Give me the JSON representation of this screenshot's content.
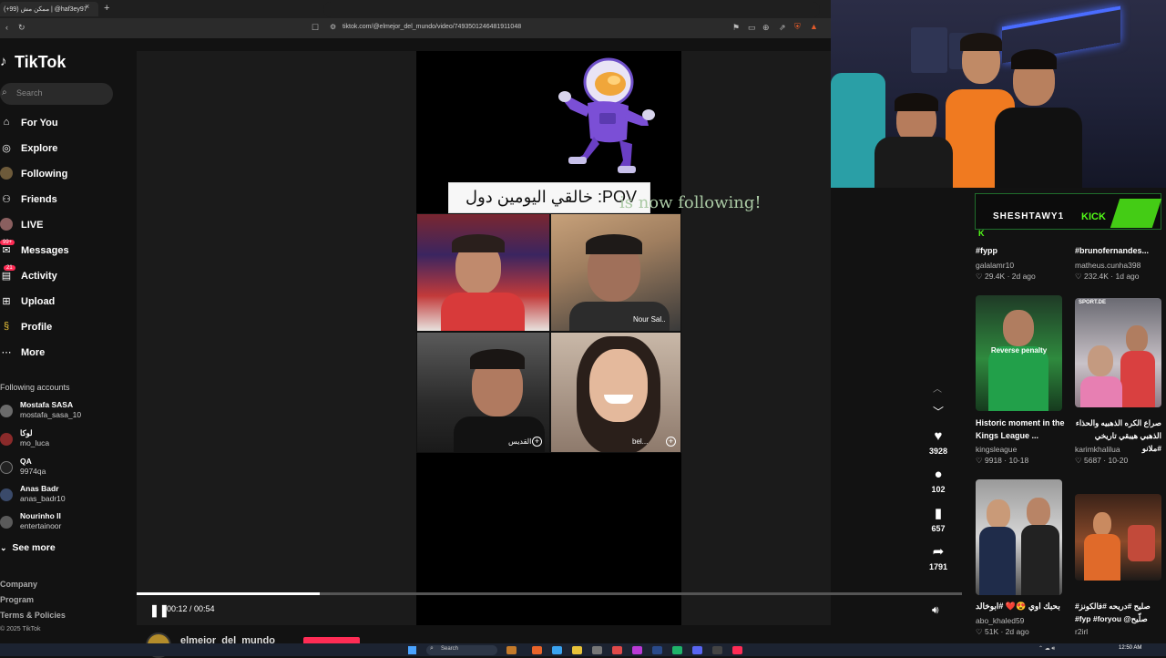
{
  "browser": {
    "tab_title": "(+99) ممكن مش | @haf3ey97",
    "tab_close": "×",
    "new_tab": "+",
    "url": "tiktok.com/@elmejor_del_mundo/video/7493501246481911048"
  },
  "sidebar": {
    "logo": "TikTok",
    "search_placeholder": "Search",
    "nav": [
      {
        "label": "For You",
        "icon": "home-icon"
      },
      {
        "label": "Explore",
        "icon": "compass-icon"
      },
      {
        "label": "Following",
        "icon": "following-icon"
      },
      {
        "label": "Friends",
        "icon": "friends-icon"
      },
      {
        "label": "LIVE",
        "icon": "live-icon"
      },
      {
        "label": "Messages",
        "icon": "messages-icon",
        "badge": "99+"
      },
      {
        "label": "Activity",
        "icon": "activity-icon",
        "badge": "21"
      },
      {
        "label": "Upload",
        "icon": "upload-icon"
      },
      {
        "label": "Profile",
        "icon": "profile-icon"
      },
      {
        "label": "More",
        "icon": "more-icon"
      }
    ],
    "following_title": "Following accounts",
    "accounts": [
      {
        "name": "Mostafa SASA",
        "handle": "mostafa_sasa_10"
      },
      {
        "name": "لوكا",
        "handle": "mo_luca"
      },
      {
        "name": "QA",
        "handle": "9974qa"
      },
      {
        "name": "Anas Badr",
        "handle": "anas_badr10"
      },
      {
        "name": "Nourinho II",
        "handle": "entertainoor"
      }
    ],
    "see_more": "See more",
    "footer": [
      "Company",
      "Program",
      "Terms & Policies",
      "© 2025 TikTok"
    ]
  },
  "video": {
    "pov_text": "خالقي اليومين دول :POV",
    "follow_overlay": "is now following!",
    "tile_labels": [
      "Nour Sal..",
      "القديس",
      "bel..."
    ],
    "time": "00:12 / 00:54",
    "progress": 0.222,
    "author": "elmejor_del_mundo"
  },
  "actions": {
    "likes": "3928",
    "comments": "102",
    "saves": "657",
    "shares": "1791"
  },
  "recommendations": [
    {
      "title": "#fypp",
      "user": "galalamr10",
      "views": "29.4K",
      "date": "2d ago"
    },
    {
      "title": "#brunofernandes...",
      "user": "matheus.cunha398",
      "views": "232.4K",
      "date": "1d ago"
    },
    {
      "title": "Historic moment in the Kings League ...",
      "user": "kingsleague",
      "views": "9918",
      "date": "10-18",
      "overlay": "Reverse penalty"
    },
    {
      "title": "صراع الكره الذهبيه والحذاء الذهبي هيبقي تاريخي #ملانو",
      "user": "karimkhalilua",
      "views": "5687",
      "date": "10-20",
      "overlay": "SPORT.DE"
    },
    {
      "title": "بحبك اوي 😍❤️ #ابوخالد",
      "user": "abo_khaled59",
      "views": "51K",
      "date": "2d ago"
    },
    {
      "title": "#صليح #دريحه #فالكونز #fyp #foryou @صلّيح",
      "user": "r2irl",
      "views": "",
      "date": ""
    }
  ],
  "stream": {
    "kick_name": "SHESHTAWY1",
    "kick_word": "KICK"
  },
  "taskbar": {
    "search": "Search",
    "time": "12:50 AM"
  },
  "colors": {
    "accent": "#fe2c55",
    "kick": "#53fc18",
    "background": "#121212"
  }
}
